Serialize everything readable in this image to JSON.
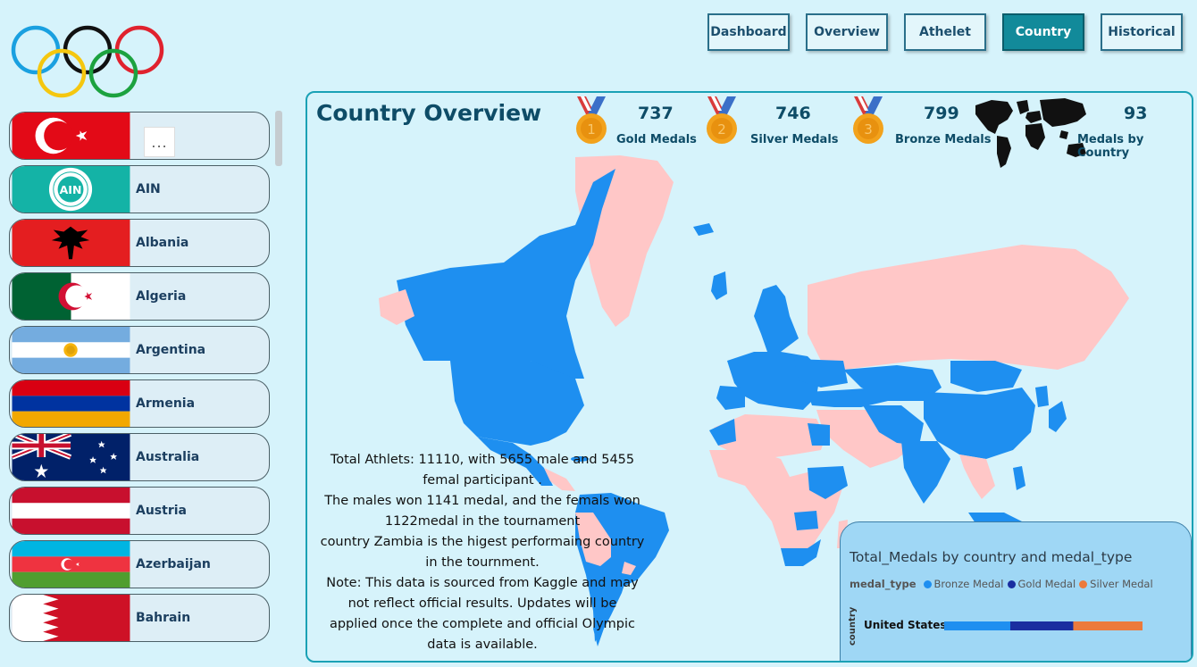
{
  "nav": {
    "items": [
      "Dashboard",
      "Overview",
      "Athelet",
      "Country",
      "Historical"
    ],
    "active": "Country"
  },
  "sidebar": {
    "more_label": "...",
    "countries": [
      {
        "name": "",
        "flag": "turkey-flag"
      },
      {
        "name": "AIN",
        "flag": "ain-emblem"
      },
      {
        "name": "Albania",
        "flag": "albania-flag"
      },
      {
        "name": "Algeria",
        "flag": "algeria-flag"
      },
      {
        "name": "Argentina",
        "flag": "argentina-flag"
      },
      {
        "name": "Armenia",
        "flag": "armenia-flag"
      },
      {
        "name": "Australia",
        "flag": "australia-flag"
      },
      {
        "name": "Austria",
        "flag": "austria-flag"
      },
      {
        "name": "Azerbaijan",
        "flag": "azerbaijan-flag"
      },
      {
        "name": "Bahrain",
        "flag": "bahrain-flag"
      }
    ]
  },
  "panel": {
    "title": "Country Overview",
    "kpis": {
      "gold": {
        "value": "737",
        "label": "Gold Medals"
      },
      "silver": {
        "value": "746",
        "label": "Silver Medals"
      },
      "bronze": {
        "value": "799",
        "label": "Bronze Medals"
      },
      "countries": {
        "value": "93",
        "label": "Medals by Country"
      }
    },
    "summary": [
      "Total Athlets: 11110, with 5655 male and 5455",
      "femal participant .",
      "The males won 1141 medal, and the femals won",
      "1122medal in the tournament",
      "country Zambia is the higest performaing country",
      "in the tournment.",
      "Note: This data is sourced from Kaggle and may",
      "not reflect official results. Updates will be",
      "applied once the complete and official Olympic",
      "data is available."
    ]
  },
  "colors": {
    "map_medal": "#1e8ff0",
    "map_no_medal": "#ffc7c7",
    "bronze": "#1e8ff0",
    "gold": "#1a2ea0",
    "silver": "#ec7a3c"
  },
  "chart_data": {
    "type": "bar",
    "orientation": "horizontal",
    "stacked": true,
    "title": "Total_Medals by country and medal_type",
    "legend_title": "medal_type",
    "ylabel": "country",
    "categories": [
      "United States"
    ],
    "series": [
      {
        "name": "Bronze Medal",
        "values": [
          42
        ]
      },
      {
        "name": "Gold Medal",
        "values": [
          40
        ]
      },
      {
        "name": "Silver Medal",
        "values": [
          44
        ]
      }
    ]
  }
}
